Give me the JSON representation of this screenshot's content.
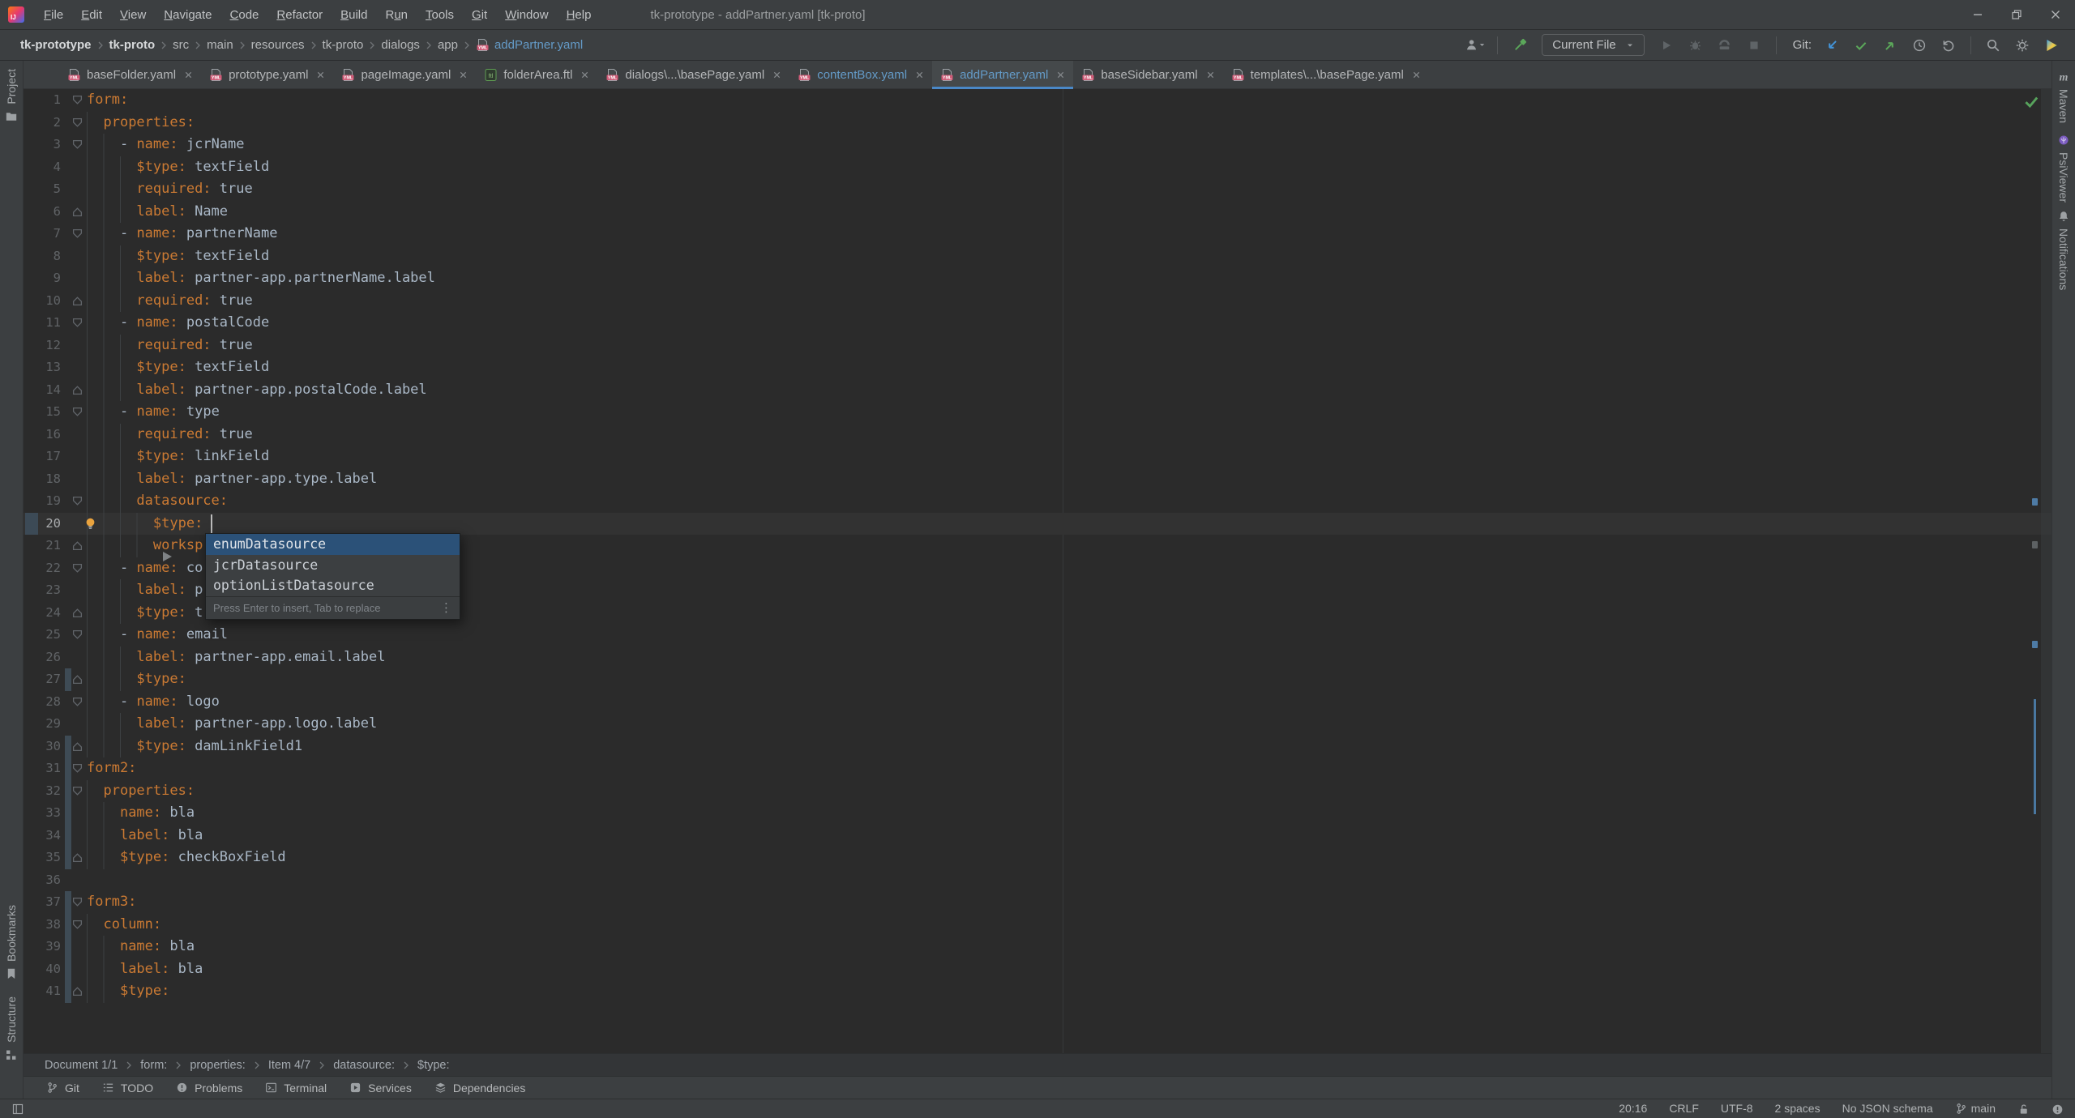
{
  "window": {
    "title": "tk-prototype - addPartner.yaml [tk-proto]"
  },
  "menu": {
    "items": [
      {
        "label": "File",
        "m": 0
      },
      {
        "label": "Edit",
        "m": 0
      },
      {
        "label": "View",
        "m": 0
      },
      {
        "label": "Navigate",
        "m": 0
      },
      {
        "label": "Code",
        "m": 0
      },
      {
        "label": "Refactor",
        "m": 0
      },
      {
        "label": "Build",
        "m": 0
      },
      {
        "label": "Run",
        "m": 1
      },
      {
        "label": "Tools",
        "m": 0
      },
      {
        "label": "Git",
        "m": 0
      },
      {
        "label": "Window",
        "m": 0
      },
      {
        "label": "Help",
        "m": 0
      }
    ]
  },
  "navbar": {
    "crumbs": [
      {
        "text": "tk-prototype",
        "bold": true
      },
      {
        "text": "tk-proto",
        "bold": true
      },
      {
        "text": "src"
      },
      {
        "text": "main"
      },
      {
        "text": "resources"
      },
      {
        "text": "tk-proto"
      },
      {
        "text": "dialogs"
      },
      {
        "text": "app"
      },
      {
        "text": "addPartner.yaml",
        "file": true
      }
    ],
    "run_config": "Current File",
    "git_label": "Git:"
  },
  "tabs": [
    {
      "label": "baseFolder.yaml",
      "icon": "yml"
    },
    {
      "label": "prototype.yaml",
      "icon": "yml"
    },
    {
      "label": "pageImage.yaml",
      "icon": "yml"
    },
    {
      "label": "folderArea.ftl",
      "icon": "ftl"
    },
    {
      "label": "dialogs\\...\\basePage.yaml",
      "icon": "yml"
    },
    {
      "label": "contentBox.yaml",
      "icon": "yml",
      "modified": true
    },
    {
      "label": "addPartner.yaml",
      "icon": "yml",
      "modified": true,
      "active": true
    },
    {
      "label": "baseSidebar.yaml",
      "icon": "yml"
    },
    {
      "label": "templates\\...\\basePage.yaml",
      "icon": "yml"
    }
  ],
  "editor": {
    "caret_line": 20,
    "bulb_line": 20,
    "lines": [
      {
        "fold": "open",
        "seg": [
          [
            "k",
            "form:"
          ]
        ]
      },
      {
        "fold": "open",
        "seg": [
          [
            "w",
            "  "
          ],
          [
            "k",
            "properties:"
          ]
        ]
      },
      {
        "fold": "open",
        "seg": [
          [
            "w",
            "    "
          ],
          [
            "p",
            "- "
          ],
          [
            "k",
            "name:"
          ],
          [
            "p",
            " jcrName"
          ]
        ]
      },
      {
        "seg": [
          [
            "w",
            "      "
          ],
          [
            "k",
            "$type:"
          ],
          [
            "p",
            " textField"
          ]
        ]
      },
      {
        "seg": [
          [
            "w",
            "      "
          ],
          [
            "k",
            "required:"
          ],
          [
            "p",
            " true"
          ]
        ]
      },
      {
        "fold": "close",
        "seg": [
          [
            "w",
            "      "
          ],
          [
            "k",
            "label:"
          ],
          [
            "p",
            " Name"
          ]
        ]
      },
      {
        "fold": "open",
        "seg": [
          [
            "w",
            "    "
          ],
          [
            "p",
            "- "
          ],
          [
            "k",
            "name:"
          ],
          [
            "p",
            " partnerName"
          ]
        ]
      },
      {
        "seg": [
          [
            "w",
            "      "
          ],
          [
            "k",
            "$type:"
          ],
          [
            "p",
            " textField"
          ]
        ]
      },
      {
        "seg": [
          [
            "w",
            "      "
          ],
          [
            "k",
            "label:"
          ],
          [
            "p",
            " partner-app.partnerName.label"
          ]
        ]
      },
      {
        "fold": "close",
        "seg": [
          [
            "w",
            "      "
          ],
          [
            "k",
            "required:"
          ],
          [
            "p",
            " true"
          ]
        ]
      },
      {
        "fold": "open",
        "seg": [
          [
            "w",
            "    "
          ],
          [
            "p",
            "- "
          ],
          [
            "k",
            "name:"
          ],
          [
            "p",
            " postalCode"
          ]
        ]
      },
      {
        "seg": [
          [
            "w",
            "      "
          ],
          [
            "k",
            "required:"
          ],
          [
            "p",
            " true"
          ]
        ]
      },
      {
        "seg": [
          [
            "w",
            "      "
          ],
          [
            "k",
            "$type:"
          ],
          [
            "p",
            " textField"
          ]
        ]
      },
      {
        "fold": "close",
        "seg": [
          [
            "w",
            "      "
          ],
          [
            "k",
            "label:"
          ],
          [
            "p",
            " partner-app.postalCode.label"
          ]
        ]
      },
      {
        "fold": "open",
        "seg": [
          [
            "w",
            "    "
          ],
          [
            "p",
            "- "
          ],
          [
            "k",
            "name:"
          ],
          [
            "p",
            " type"
          ]
        ]
      },
      {
        "seg": [
          [
            "w",
            "      "
          ],
          [
            "k",
            "required:"
          ],
          [
            "p",
            " true"
          ]
        ]
      },
      {
        "seg": [
          [
            "w",
            "      "
          ],
          [
            "k",
            "$type:"
          ],
          [
            "p",
            " linkField"
          ]
        ]
      },
      {
        "seg": [
          [
            "w",
            "      "
          ],
          [
            "k",
            "label:"
          ],
          [
            "p",
            " partner-app.type.label"
          ]
        ]
      },
      {
        "fold": "open",
        "seg": [
          [
            "w",
            "      "
          ],
          [
            "k",
            "datasource:"
          ]
        ]
      },
      {
        "seg": [
          [
            "w",
            "        "
          ],
          [
            "k",
            "$type:"
          ]
        ]
      },
      {
        "fold": "close",
        "seg": [
          [
            "w",
            "        "
          ],
          [
            "k",
            "worksp"
          ]
        ]
      },
      {
        "fold": "open",
        "seg": [
          [
            "w",
            "    "
          ],
          [
            "p",
            "- "
          ],
          [
            "k",
            "name:"
          ],
          [
            "p",
            " co"
          ]
        ]
      },
      {
        "seg": [
          [
            "w",
            "      "
          ],
          [
            "k",
            "label:"
          ],
          [
            "p",
            " p"
          ]
        ]
      },
      {
        "fold": "close",
        "seg": [
          [
            "w",
            "      "
          ],
          [
            "k",
            "$type:"
          ],
          [
            "p",
            " t"
          ]
        ]
      },
      {
        "fold": "open",
        "seg": [
          [
            "w",
            "    "
          ],
          [
            "p",
            "- "
          ],
          [
            "k",
            "name:"
          ],
          [
            "p",
            " email"
          ]
        ]
      },
      {
        "seg": [
          [
            "w",
            "      "
          ],
          [
            "k",
            "label:"
          ],
          [
            "p",
            " partner-app.email.label"
          ]
        ]
      },
      {
        "fold": "close",
        "chg": true,
        "seg": [
          [
            "w",
            "      "
          ],
          [
            "k",
            "$type:"
          ]
        ]
      },
      {
        "fold": "open",
        "seg": [
          [
            "w",
            "    "
          ],
          [
            "p",
            "- "
          ],
          [
            "k",
            "name:"
          ],
          [
            "p",
            " logo"
          ]
        ]
      },
      {
        "seg": [
          [
            "w",
            "      "
          ],
          [
            "k",
            "label:"
          ],
          [
            "p",
            " partner-app.logo.label"
          ]
        ]
      },
      {
        "fold": "close",
        "chg": true,
        "seg": [
          [
            "w",
            "      "
          ],
          [
            "k",
            "$type:"
          ],
          [
            "p",
            " damLinkField1"
          ]
        ]
      },
      {
        "fold": "open",
        "chg": true,
        "seg": [
          [
            "k",
            "form2:"
          ]
        ]
      },
      {
        "fold": "open",
        "chg": true,
        "seg": [
          [
            "w",
            "  "
          ],
          [
            "k",
            "properties:"
          ]
        ]
      },
      {
        "chg": true,
        "seg": [
          [
            "w",
            "    "
          ],
          [
            "k",
            "name:"
          ],
          [
            "p",
            " bla"
          ]
        ]
      },
      {
        "chg": true,
        "seg": [
          [
            "w",
            "    "
          ],
          [
            "k",
            "label:"
          ],
          [
            "p",
            " bla"
          ]
        ]
      },
      {
        "fold": "close",
        "chg": true,
        "seg": [
          [
            "w",
            "    "
          ],
          [
            "k",
            "$type:"
          ],
          [
            "p",
            " checkBoxField"
          ]
        ]
      },
      {
        "seg": []
      },
      {
        "fold": "open",
        "chg": true,
        "seg": [
          [
            "k",
            "form3:"
          ]
        ]
      },
      {
        "fold": "open",
        "chg": true,
        "seg": [
          [
            "w",
            "  "
          ],
          [
            "k",
            "column:"
          ]
        ]
      },
      {
        "chg": true,
        "seg": [
          [
            "w",
            "    "
          ],
          [
            "k",
            "name:"
          ],
          [
            "p",
            " bla"
          ]
        ]
      },
      {
        "chg": true,
        "seg": [
          [
            "w",
            "    "
          ],
          [
            "k",
            "label:"
          ],
          [
            "p",
            " bla"
          ]
        ]
      },
      {
        "fold": "close",
        "chg": true,
        "seg": [
          [
            "w",
            "    "
          ],
          [
            "k",
            "$type:"
          ]
        ]
      }
    ]
  },
  "popup": {
    "items": [
      "enumDatasource",
      "jcrDatasource",
      "optionListDatasource"
    ],
    "selected_index": 0,
    "hint": "Press Enter to insert, Tab to replace"
  },
  "bottom_breadcrumbs": [
    "Document 1/1",
    "form:",
    "properties:",
    "Item 4/7",
    "datasource:",
    "$type:"
  ],
  "tool_windows": {
    "bottom": [
      {
        "label": "Git",
        "icon": "branch"
      },
      {
        "label": "TODO",
        "icon": "todo"
      },
      {
        "label": "Problems",
        "icon": "problem"
      },
      {
        "label": "Terminal",
        "icon": "terminal"
      },
      {
        "label": "Services",
        "icon": "services"
      },
      {
        "label": "Dependencies",
        "icon": "deps"
      }
    ],
    "left_top": [
      {
        "label": "Project",
        "icon": "folder"
      }
    ],
    "left_bottom": [
      {
        "label": "Bookmarks",
        "icon": "bookmark"
      },
      {
        "label": "Structure",
        "icon": "structure"
      }
    ],
    "right": [
      {
        "label": "Maven",
        "icon": "maven"
      },
      {
        "label": "PsiViewer",
        "icon": "psi"
      },
      {
        "label": "Notifications",
        "icon": "bell"
      }
    ]
  },
  "statusbar": {
    "items": [
      "20:16",
      "CRLF",
      "UTF-8",
      "2 spaces",
      "No JSON schema"
    ],
    "branch": "main"
  },
  "colors": {
    "accent_blue": "#4a88c7",
    "key_orange": "#cb7a33",
    "code_text": "#a9b7c6",
    "modified_blue": "#649bc8",
    "selection_blue": "#2b5178",
    "green_ok": "#57a35c",
    "editor_bg": "#2b2b2b",
    "chrome_bg": "#3c3f41"
  }
}
